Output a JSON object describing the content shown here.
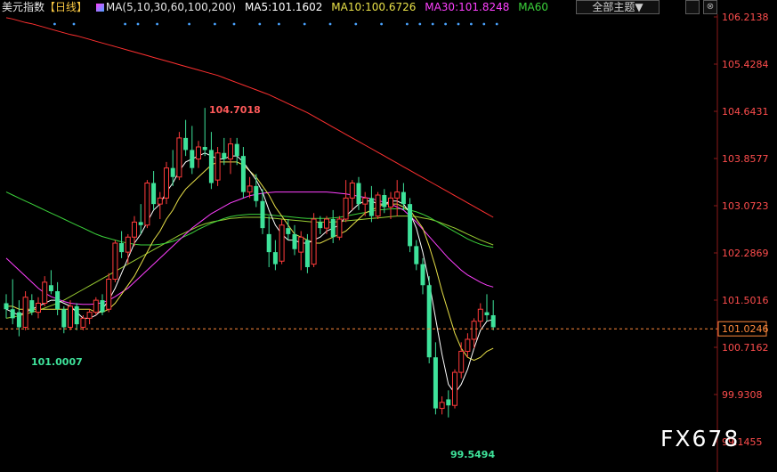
{
  "header": {
    "instrument": "美元指数",
    "period": "【日线】",
    "ma_label": "MA(5,10,30,60,100,200)",
    "ma5": "MA5:101.1602",
    "ma10": "MA10:100.6726",
    "ma30": "MA30:101.8248",
    "ma60": "MA60",
    "theme_button": "全部主题▼",
    "box1": "",
    "box2": "⊗"
  },
  "watermark": "FX678",
  "colors": {
    "up": "#ff3b3b",
    "down": "#3ee29a",
    "ma5": "#ffffff",
    "ma10": "#e8e048",
    "ma30": "#ff40ff",
    "ma60": "#3bd23b",
    "ma100": "#9acd32",
    "ma200": "#ff3030",
    "price_axis": "#ff4d4d",
    "dots": "#4aa3ff"
  },
  "chart_data": {
    "type": "candlestick",
    "y_ticks": [
      "106.2138",
      "105.4284",
      "104.6431",
      "103.8577",
      "103.0723",
      "102.2869",
      "101.5016",
      "100.7162",
      "99.9308",
      "99.1455"
    ],
    "ylim": [
      99.1455,
      106.2138
    ],
    "current_price": "101.0246",
    "annotations": {
      "high": "104.7018",
      "low_left": "101.0007",
      "low_bottom": "99.5494"
    },
    "candles": [
      [
        101.45,
        101.6,
        101.2,
        101.35
      ],
      [
        101.35,
        101.85,
        101.1,
        101.2
      ],
      [
        101.3,
        101.5,
        100.9,
        101.05
      ],
      [
        101.05,
        101.65,
        101.0,
        101.55
      ],
      [
        101.5,
        101.6,
        101.25,
        101.3
      ],
      [
        101.3,
        101.55,
        101.2,
        101.45
      ],
      [
        101.45,
        101.9,
        101.4,
        101.8
      ],
      [
        101.75,
        102.0,
        101.6,
        101.65
      ],
      [
        101.65,
        101.8,
        101.25,
        101.35
      ],
      [
        101.35,
        101.4,
        100.95,
        101.05
      ],
      [
        101.05,
        101.5,
        101.0,
        101.4
      ],
      [
        101.4,
        101.45,
        101.0,
        101.1
      ],
      [
        101.05,
        101.25,
        101.0,
        101.2
      ],
      [
        101.2,
        101.35,
        101.1,
        101.3
      ],
      [
        101.3,
        101.55,
        101.25,
        101.5
      ],
      [
        101.5,
        101.6,
        101.25,
        101.3
      ],
      [
        101.35,
        101.95,
        101.3,
        101.85
      ],
      [
        101.85,
        102.5,
        101.8,
        102.45
      ],
      [
        102.45,
        102.65,
        102.2,
        102.3
      ],
      [
        102.3,
        102.6,
        102.1,
        102.55
      ],
      [
        102.55,
        102.9,
        102.4,
        102.8
      ],
      [
        102.8,
        103.1,
        102.6,
        102.75
      ],
      [
        102.75,
        103.5,
        102.7,
        103.45
      ],
      [
        103.45,
        103.65,
        103.0,
        103.1
      ],
      [
        103.1,
        103.3,
        102.85,
        103.2
      ],
      [
        103.2,
        103.8,
        103.1,
        103.7
      ],
      [
        103.7,
        104.0,
        103.4,
        103.55
      ],
      [
        103.55,
        104.3,
        103.5,
        104.2
      ],
      [
        104.2,
        104.5,
        103.9,
        104.0
      ],
      [
        104.0,
        104.4,
        103.6,
        103.7
      ],
      [
        103.85,
        104.15,
        103.7,
        104.05
      ],
      [
        104.05,
        104.7,
        103.9,
        104.0
      ],
      [
        104.0,
        104.3,
        103.35,
        103.45
      ],
      [
        103.5,
        104.05,
        103.4,
        103.95
      ],
      [
        103.95,
        104.2,
        103.75,
        103.85
      ],
      [
        103.85,
        104.2,
        103.6,
        104.1
      ],
      [
        104.1,
        104.2,
        103.75,
        103.9
      ],
      [
        103.9,
        104.05,
        103.2,
        103.3
      ],
      [
        103.3,
        103.55,
        103.2,
        103.4
      ],
      [
        103.4,
        103.6,
        103.05,
        103.15
      ],
      [
        103.15,
        103.35,
        102.6,
        102.7
      ],
      [
        102.6,
        102.9,
        102.05,
        102.3
      ],
      [
        102.3,
        102.5,
        102.0,
        102.1
      ],
      [
        102.15,
        102.85,
        102.1,
        102.75
      ],
      [
        102.7,
        102.85,
        102.5,
        102.6
      ],
      [
        102.6,
        102.75,
        102.25,
        102.35
      ],
      [
        102.3,
        102.65,
        102.0,
        102.55
      ],
      [
        102.5,
        102.6,
        101.95,
        102.05
      ],
      [
        102.1,
        102.95,
        102.05,
        102.85
      ],
      [
        102.8,
        102.9,
        102.6,
        102.7
      ],
      [
        102.7,
        102.9,
        102.6,
        102.85
      ],
      [
        102.85,
        103.0,
        102.45,
        102.55
      ],
      [
        102.55,
        102.9,
        102.5,
        102.85
      ],
      [
        102.85,
        103.5,
        102.8,
        103.2
      ],
      [
        103.2,
        103.5,
        103.0,
        103.45
      ],
      [
        103.45,
        103.55,
        103.0,
        103.1
      ],
      [
        103.1,
        103.3,
        102.9,
        103.2
      ],
      [
        103.2,
        103.4,
        102.8,
        102.9
      ],
      [
        102.9,
        103.3,
        102.85,
        103.25
      ],
      [
        103.25,
        103.35,
        102.95,
        103.05
      ],
      [
        103.05,
        103.3,
        102.85,
        103.2
      ],
      [
        103.2,
        103.5,
        102.9,
        103.3
      ],
      [
        103.3,
        103.45,
        103.0,
        103.1
      ],
      [
        103.1,
        103.2,
        102.3,
        102.4
      ],
      [
        102.4,
        102.5,
        102.0,
        102.1
      ],
      [
        102.1,
        102.2,
        101.6,
        101.75
      ],
      [
        101.75,
        101.9,
        100.45,
        100.55
      ],
      [
        100.55,
        100.8,
        99.6,
        99.7
      ],
      [
        99.7,
        99.9,
        99.6,
        99.8
      ],
      [
        99.85,
        100.0,
        99.55,
        99.75
      ],
      [
        99.75,
        100.35,
        99.7,
        100.3
      ],
      [
        100.3,
        100.8,
        100.2,
        100.65
      ],
      [
        100.65,
        100.95,
        100.55,
        100.85
      ],
      [
        100.85,
        101.2,
        100.7,
        101.15
      ],
      [
        101.15,
        101.45,
        101.05,
        101.35
      ],
      [
        101.3,
        101.6,
        101.15,
        101.25
      ],
      [
        101.25,
        101.5,
        101.0,
        101.05
      ]
    ],
    "ma5": [
      101.35,
      101.3,
      101.25,
      101.3,
      101.35,
      101.4,
      101.45,
      101.5,
      101.5,
      101.45,
      101.4,
      101.3,
      101.2,
      101.2,
      101.25,
      101.35,
      101.5,
      101.7,
      101.95,
      102.2,
      102.45,
      102.6,
      102.8,
      103.0,
      103.1,
      103.3,
      103.45,
      103.65,
      103.8,
      103.85,
      103.9,
      103.95,
      103.9,
      103.85,
      103.85,
      103.9,
      103.9,
      103.8,
      103.65,
      103.5,
      103.3,
      103.0,
      102.75,
      102.6,
      102.5,
      102.5,
      102.45,
      102.45,
      102.5,
      102.55,
      102.65,
      102.7,
      102.75,
      102.9,
      103.0,
      103.1,
      103.15,
      103.15,
      103.1,
      103.1,
      103.15,
      103.15,
      103.1,
      102.95,
      102.7,
      102.3,
      101.8,
      101.2,
      100.6,
      100.1,
      99.95,
      100.1,
      100.35,
      100.7,
      101.0,
      101.15,
      101.18
    ],
    "ma10": [
      101.4,
      101.4,
      101.35,
      101.35,
      101.35,
      101.35,
      101.35,
      101.35,
      101.35,
      101.35,
      101.35,
      101.35,
      101.35,
      101.35,
      101.3,
      101.3,
      101.35,
      101.45,
      101.6,
      101.75,
      101.9,
      102.1,
      102.3,
      102.5,
      102.65,
      102.85,
      103.0,
      103.2,
      103.35,
      103.45,
      103.55,
      103.65,
      103.75,
      103.8,
      103.8,
      103.8,
      103.8,
      103.75,
      103.65,
      103.55,
      103.4,
      103.25,
      103.05,
      102.9,
      102.75,
      102.6,
      102.55,
      102.5,
      102.45,
      102.45,
      102.5,
      102.55,
      102.6,
      102.65,
      102.75,
      102.85,
      102.95,
      103.0,
      103.05,
      103.1,
      103.1,
      103.1,
      103.05,
      103.0,
      102.85,
      102.7,
      102.4,
      102.05,
      101.65,
      101.3,
      100.95,
      100.7,
      100.55,
      100.5,
      100.55,
      100.65,
      100.7
    ],
    "ma30": [
      102.2,
      102.1,
      102.0,
      101.9,
      101.8,
      101.7,
      101.62,
      101.56,
      101.52,
      101.48,
      101.45,
      101.44,
      101.43,
      101.43,
      101.44,
      101.46,
      101.5,
      101.56,
      101.63,
      101.7,
      101.8,
      101.9,
      102.0,
      102.1,
      102.2,
      102.3,
      102.4,
      102.5,
      102.6,
      102.7,
      102.78,
      102.86,
      102.94,
      103.0,
      103.06,
      103.12,
      103.16,
      103.2,
      103.24,
      103.26,
      103.28,
      103.29,
      103.3,
      103.3,
      103.3,
      103.3,
      103.3,
      103.3,
      103.3,
      103.3,
      103.3,
      103.29,
      103.28,
      103.27,
      103.25,
      103.23,
      103.21,
      103.19,
      103.16,
      103.13,
      103.1,
      103.05,
      103.0,
      102.9,
      102.8,
      102.68,
      102.56,
      102.44,
      102.32,
      102.2,
      102.1,
      102.0,
      101.92,
      101.86,
      101.8,
      101.75,
      101.72
    ],
    "ma60": [
      103.3,
      103.25,
      103.2,
      103.15,
      103.1,
      103.05,
      103.0,
      102.95,
      102.9,
      102.85,
      102.8,
      102.75,
      102.7,
      102.65,
      102.6,
      102.56,
      102.53,
      102.5,
      102.47,
      102.45,
      102.43,
      102.42,
      102.42,
      102.42,
      102.43,
      102.45,
      102.48,
      102.52,
      102.57,
      102.62,
      102.68,
      102.73,
      102.78,
      102.82,
      102.86,
      102.89,
      102.91,
      102.92,
      102.93,
      102.93,
      102.93,
      102.92,
      102.91,
      102.9,
      102.89,
      102.88,
      102.87,
      102.86,
      102.86,
      102.86,
      102.86,
      102.87,
      102.88,
      102.9,
      102.92,
      102.94,
      102.96,
      102.98,
      103.0,
      103.01,
      103.02,
      103.02,
      103.02,
      103.0,
      102.97,
      102.93,
      102.88,
      102.82,
      102.76,
      102.7,
      102.64,
      102.58,
      102.52,
      102.47,
      102.43,
      102.4,
      102.38
    ],
    "ma100": [
      101.2,
      101.22,
      101.24,
      101.27,
      101.3,
      101.33,
      101.37,
      101.41,
      101.45,
      101.5,
      101.56,
      101.62,
      101.68,
      101.74,
      101.8,
      101.86,
      101.92,
      101.98,
      102.04,
      102.1,
      102.16,
      102.22,
      102.28,
      102.34,
      102.4,
      102.46,
      102.52,
      102.58,
      102.63,
      102.68,
      102.73,
      102.77,
      102.8,
      102.82,
      102.84,
      102.86,
      102.87,
      102.88,
      102.88,
      102.88,
      102.88,
      102.87,
      102.86,
      102.85,
      102.84,
      102.83,
      102.82,
      102.81,
      102.8,
      102.8,
      102.8,
      102.8,
      102.81,
      102.82,
      102.83,
      102.84,
      102.85,
      102.86,
      102.87,
      102.88,
      102.89,
      102.9,
      102.9,
      102.9,
      102.89,
      102.87,
      102.85,
      102.82,
      102.78,
      102.74,
      102.7,
      102.65,
      102.6,
      102.55,
      102.5,
      102.46,
      102.42
    ],
    "ma200": [
      106.2,
      106.18,
      106.15,
      106.12,
      106.1,
      106.07,
      106.04,
      106.01,
      105.98,
      105.95,
      105.92,
      105.9,
      105.87,
      105.84,
      105.81,
      105.78,
      105.75,
      105.72,
      105.69,
      105.66,
      105.63,
      105.6,
      105.57,
      105.54,
      105.51,
      105.48,
      105.45,
      105.42,
      105.39,
      105.36,
      105.33,
      105.3,
      105.27,
      105.24,
      105.2,
      105.16,
      105.12,
      105.08,
      105.04,
      105.0,
      104.96,
      104.92,
      104.87,
      104.82,
      104.77,
      104.72,
      104.67,
      104.62,
      104.56,
      104.5,
      104.44,
      104.38,
      104.32,
      104.26,
      104.2,
      104.14,
      104.08,
      104.02,
      103.96,
      103.9,
      103.84,
      103.78,
      103.72,
      103.66,
      103.6,
      103.54,
      103.48,
      103.42,
      103.36,
      103.3,
      103.24,
      103.18,
      103.12,
      103.06,
      103.0,
      102.94,
      102.88
    ],
    "signal_dots": [
      7,
      10,
      18,
      20,
      23,
      28,
      32,
      35,
      39,
      42,
      46,
      50,
      54,
      58,
      62,
      64,
      66,
      68,
      70,
      72,
      74,
      76
    ]
  }
}
